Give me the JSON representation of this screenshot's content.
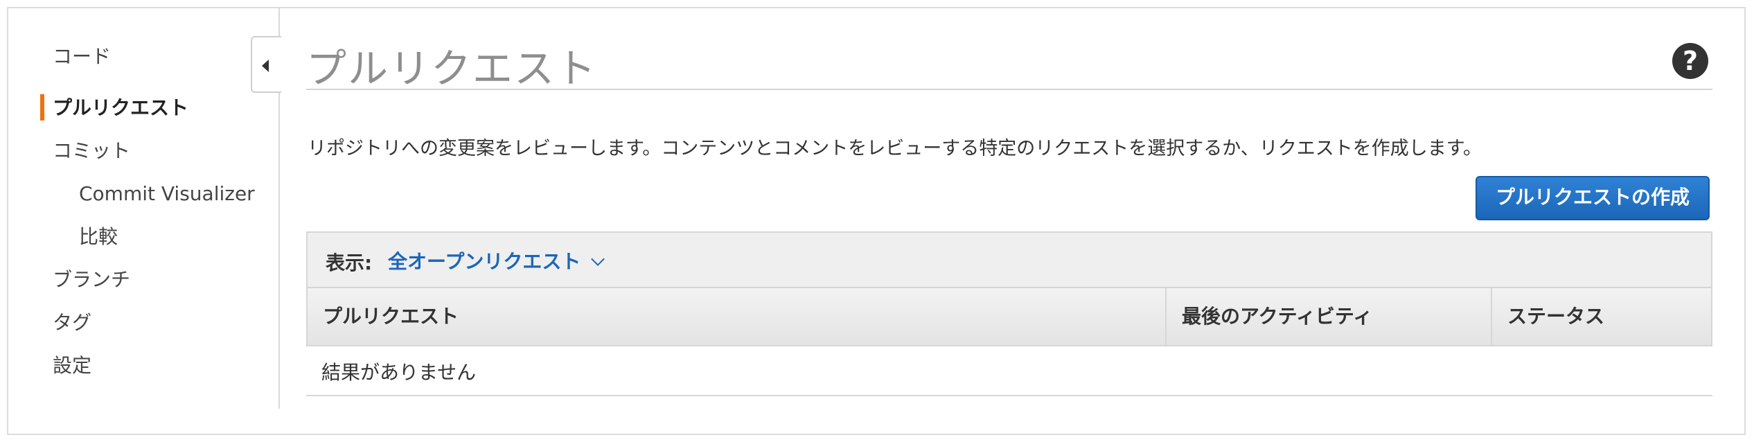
{
  "sidebar": {
    "items": [
      {
        "label": "コード"
      },
      {
        "label": "プルリクエスト"
      },
      {
        "label": "コミット"
      },
      {
        "label": "Commit Visualizer"
      },
      {
        "label": "比較"
      },
      {
        "label": "ブランチ"
      },
      {
        "label": "タグ"
      },
      {
        "label": "設定"
      }
    ],
    "active_color": "#ec7211"
  },
  "header": {
    "title": "プルリクエスト",
    "help_glyph": "?"
  },
  "main": {
    "description": "リポジトリへの変更案をレビューします。コンテンツとコメントをレビューする特定のリクエストを選択するか、リクエストを作成します。",
    "create_button_label": "プルリクエストの作成",
    "filter": {
      "label": "表示:",
      "selected": "全オープンリクエスト"
    },
    "table": {
      "columns": [
        "プルリクエスト",
        "最後のアクティビティ",
        "ステータス"
      ],
      "empty_message": "結果がありません"
    }
  },
  "colors": {
    "accent": "#ec7211",
    "primary_button": "#1c66b8",
    "link": "#1c66b8"
  }
}
